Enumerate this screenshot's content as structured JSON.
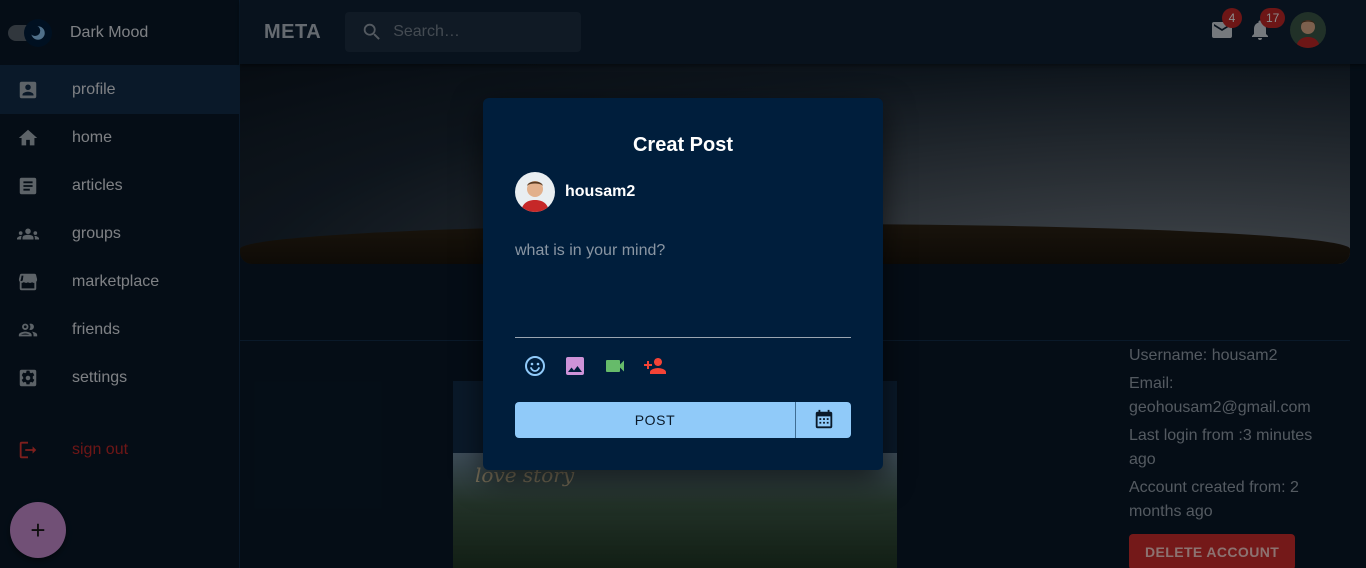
{
  "sidebar": {
    "mode_label": "Dark Mood",
    "items": [
      {
        "label": "profile",
        "icon": "profile-icon"
      },
      {
        "label": "home",
        "icon": "home-icon"
      },
      {
        "label": "articles",
        "icon": "article-icon"
      },
      {
        "label": "groups",
        "icon": "groups-icon"
      },
      {
        "label": "marketplace",
        "icon": "store-icon"
      },
      {
        "label": "friends",
        "icon": "people-icon"
      },
      {
        "label": "settings",
        "icon": "settings-icon"
      },
      {
        "label": "sign out",
        "icon": "logout-icon"
      }
    ],
    "fab_label": "+"
  },
  "header": {
    "brand": "META",
    "search_placeholder": "Search…",
    "mail_count": "4",
    "notification_count": "17"
  },
  "profile_info": {
    "username": "Username: housam2",
    "email_label": "Email:",
    "email": "geohousam2@gmail.com",
    "last_login": "Last login from :3 minutes ago",
    "created": "Account created from: 2 months ago",
    "delete_label": "DELETE ACCOUNT"
  },
  "post_card": {
    "caption": "love story"
  },
  "modal": {
    "title": "Creat Post",
    "username": "housam2",
    "placeholder": "what is in your mind?",
    "post_label": "POST",
    "tools": [
      "emoji-icon",
      "image-icon",
      "video-icon",
      "tag-person-icon"
    ]
  },
  "colors": {
    "background": "#0a1929",
    "modal": "#001e3c",
    "accent": "#90caf9",
    "danger": "#d32f2f",
    "fab": "#ce93d8"
  }
}
